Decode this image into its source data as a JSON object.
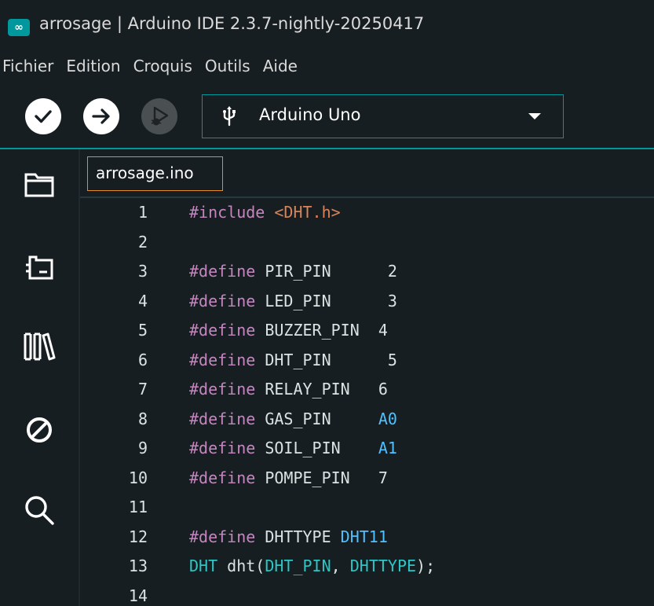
{
  "window": {
    "icon_glyph": "∞",
    "title": "arrosage | Arduino IDE 2.3.7-nightly-20250417"
  },
  "menu": [
    "Fichier",
    "Edition",
    "Croquis",
    "Outils",
    "Aide"
  ],
  "toolbar": {
    "verify_icon": "checkmark-icon",
    "upload_icon": "arrow-right-icon",
    "debug_icon": "debug-icon",
    "board_name": "Arduino Uno"
  },
  "sidebar": [
    "folder-icon",
    "board-manager-icon",
    "library-icon",
    "debug-disabled-icon",
    "search-icon"
  ],
  "tabs": [
    {
      "label": "arrosage.ino"
    }
  ],
  "code": [
    {
      "n": "1",
      "tokens": [
        [
          "pre",
          "#include "
        ],
        [
          "str",
          "<DHT.h>"
        ]
      ]
    },
    {
      "n": "2",
      "tokens": []
    },
    {
      "n": "3",
      "tokens": [
        [
          "pre",
          "#define "
        ],
        [
          "def",
          "PIR_PIN      "
        ],
        [
          "num",
          "2"
        ]
      ]
    },
    {
      "n": "4",
      "tokens": [
        [
          "pre",
          "#define "
        ],
        [
          "def",
          "LED_PIN      "
        ],
        [
          "num",
          "3"
        ]
      ]
    },
    {
      "n": "5",
      "tokens": [
        [
          "pre",
          "#define "
        ],
        [
          "def",
          "BUZZER_PIN  "
        ],
        [
          "num",
          "4"
        ]
      ]
    },
    {
      "n": "6",
      "tokens": [
        [
          "pre",
          "#define "
        ],
        [
          "def",
          "DHT_PIN      "
        ],
        [
          "num",
          "5"
        ]
      ]
    },
    {
      "n": "7",
      "tokens": [
        [
          "pre",
          "#define "
        ],
        [
          "def",
          "RELAY_PIN   "
        ],
        [
          "num",
          "6"
        ]
      ]
    },
    {
      "n": "8",
      "tokens": [
        [
          "pre",
          "#define "
        ],
        [
          "def",
          "GAS_PIN     "
        ],
        [
          "const",
          "A0"
        ]
      ]
    },
    {
      "n": "9",
      "tokens": [
        [
          "pre",
          "#define "
        ],
        [
          "def",
          "SOIL_PIN    "
        ],
        [
          "const",
          "A1"
        ]
      ]
    },
    {
      "n": "10",
      "tokens": [
        [
          "pre",
          "#define "
        ],
        [
          "def",
          "POMPE_PIN   "
        ],
        [
          "num",
          "7"
        ]
      ]
    },
    {
      "n": "11",
      "tokens": []
    },
    {
      "n": "12",
      "tokens": [
        [
          "pre",
          "#define "
        ],
        [
          "def",
          "DHTTYPE "
        ],
        [
          "const",
          "DHT11"
        ]
      ]
    },
    {
      "n": "13",
      "tokens": [
        [
          "type",
          "DHT "
        ],
        [
          "txt",
          "dht("
        ],
        [
          "type",
          "DHT_PIN"
        ],
        [
          "txt",
          ", "
        ],
        [
          "type",
          "DHTTYPE"
        ],
        [
          "txt",
          ");"
        ]
      ]
    },
    {
      "n": "14",
      "tokens": []
    }
  ],
  "colors": {
    "accent": "#00979d",
    "tab_border": "#e48c2a",
    "background": "#171e21"
  }
}
